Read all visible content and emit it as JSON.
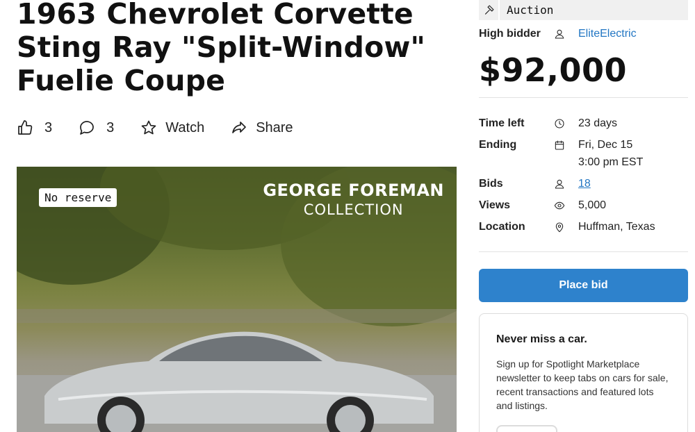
{
  "listing": {
    "title": "1963 Chevrolet Corvette Sting Ray \"Split-Window\" Fuelie Coupe"
  },
  "actions": {
    "likes": "3",
    "comments": "3",
    "watch_label": "Watch",
    "share_label": "Share"
  },
  "photo": {
    "badge": "No reserve",
    "collection_line1": "GEORGE FOREMAN",
    "collection_line2": "COLLECTION"
  },
  "sidebar": {
    "type_label": "Auction",
    "high_bidder_label": "High bidder",
    "high_bidder": "EliteElectric",
    "price": "$92,000",
    "time_left_label": "Time left",
    "time_left": "23 days",
    "ending_label": "Ending",
    "ending_date": "Fri, Dec 15",
    "ending_time": "3:00 pm EST",
    "bids_label": "Bids",
    "bids": "18",
    "views_label": "Views",
    "views": "5,000",
    "location_label": "Location",
    "location": "Huffman, Texas",
    "place_bid": "Place bid"
  },
  "newsletter": {
    "heading": "Never miss a car.",
    "body": "Sign up for Spotlight Marketplace newsletter to keep tabs on cars for sale, recent transactions and featured lots and listings."
  },
  "colors": {
    "accent": "#2e82cc",
    "link": "#2276c3",
    "chip_bg": "#f0f0f0"
  },
  "icons": [
    "thumbs-up-icon",
    "comment-icon",
    "star-icon",
    "share-icon",
    "gavel-icon",
    "user-icon",
    "clock-icon",
    "calendar-icon",
    "eye-icon",
    "map-pin-icon"
  ]
}
